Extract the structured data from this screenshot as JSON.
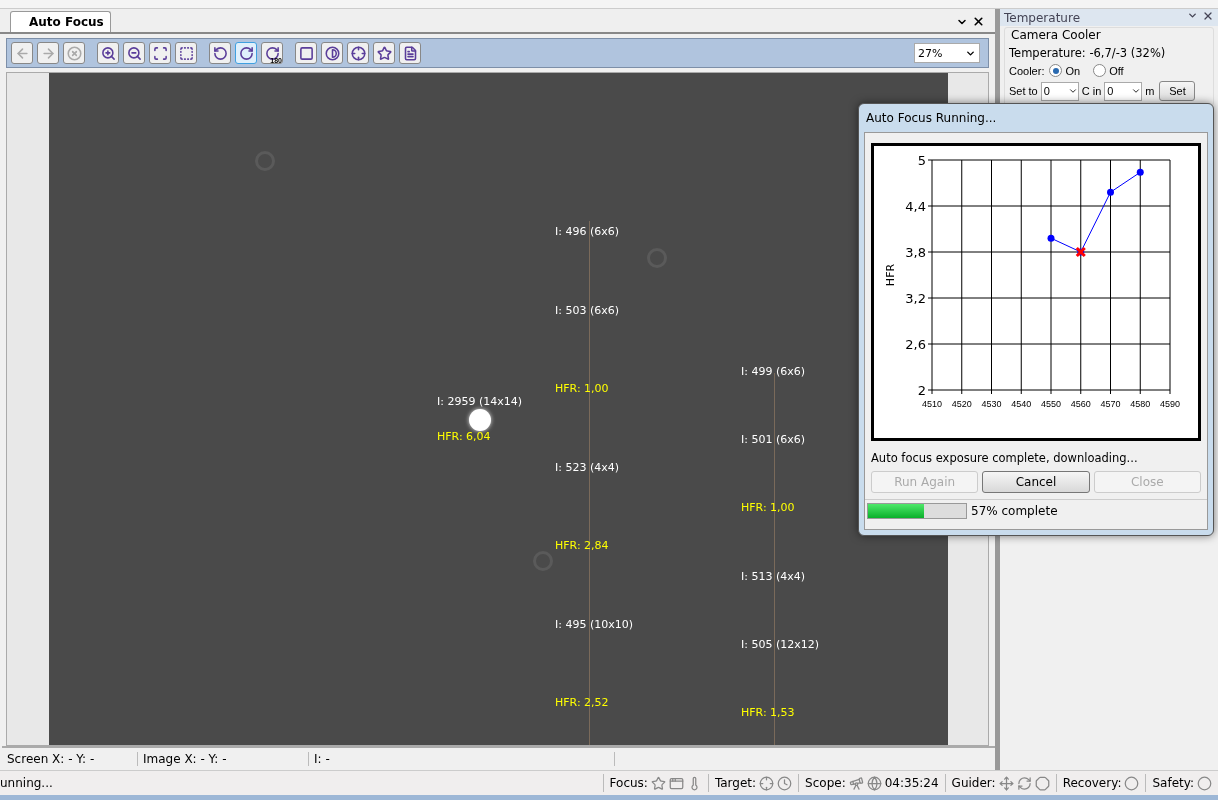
{
  "document_tab": {
    "label": "Auto Focus",
    "selected": true
  },
  "toolbar": {
    "tools": [
      {
        "kind": "back",
        "disabled": true,
        "selected": false
      },
      {
        "kind": "forward",
        "disabled": true,
        "selected": false
      },
      {
        "kind": "stop",
        "disabled": true,
        "selected": false
      },
      {
        "kind": "zoom-in",
        "disabled": false,
        "selected": false
      },
      {
        "kind": "zoom-out",
        "disabled": false,
        "selected": false
      },
      {
        "kind": "zoom-fit",
        "disabled": false,
        "selected": false
      },
      {
        "kind": "select",
        "disabled": false,
        "selected": false
      },
      {
        "kind": "rotate-left",
        "disabled": false,
        "selected": false
      },
      {
        "kind": "rotate-right",
        "disabled": false,
        "selected": true
      },
      {
        "kind": "rotate-180",
        "disabled": false,
        "selected": false,
        "badge": "180"
      },
      {
        "kind": "stretch",
        "disabled": false,
        "selected": false
      },
      {
        "kind": "contrast",
        "disabled": false,
        "selected": false
      },
      {
        "kind": "crosshair",
        "disabled": false,
        "selected": false
      },
      {
        "kind": "star",
        "disabled": false,
        "selected": false
      },
      {
        "kind": "info",
        "disabled": false,
        "selected": false
      }
    ],
    "zoom": "27%"
  },
  "image": {
    "star_clusters": [
      {
        "labels": [
          {
            "kind": "intensity",
            "text": "I: 2959 (14x14)"
          },
          {
            "kind": "hfr",
            "text": "HFR: 6,04"
          }
        ]
      },
      {
        "labels": [
          {
            "kind": "intensity",
            "text": "I: 496 (6x6)"
          },
          {
            "kind": "intensity",
            "text": "I: 503 (6x6)"
          },
          {
            "kind": "hfr",
            "text": "HFR: 1,00"
          },
          {
            "kind": "intensity",
            "text": "I: 523 (4x4)"
          },
          {
            "kind": "hfr",
            "text": "HFR: 2,84"
          },
          {
            "kind": "intensity",
            "text": "I: 495 (10x10)"
          },
          {
            "kind": "hfr",
            "text": "HFR: 2,52"
          }
        ]
      },
      {
        "labels": [
          {
            "kind": "intensity",
            "text": "I: 499 (6x6)"
          },
          {
            "kind": "intensity",
            "text": "I: 501 (6x6)"
          },
          {
            "kind": "hfr",
            "text": "HFR: 1,00"
          },
          {
            "kind": "intensity",
            "text": "I: 513 (4x4)"
          },
          {
            "kind": "intensity",
            "text": "I: 505 (12x12)"
          },
          {
            "kind": "hfr",
            "text": "HFR: 1,53"
          }
        ]
      }
    ]
  },
  "coordinates": [
    "Screen X: - Y: -",
    "Image X: - Y: -",
    "I: -"
  ],
  "temperature_panel": {
    "title": "Temperature",
    "group": "Camera Cooler",
    "reading": "Temperature: -6,7/-3 (32%)",
    "cooler_label": "Cooler:",
    "cooler_options": [
      {
        "label": "On",
        "selected": true
      },
      {
        "label": "Off",
        "selected": false
      }
    ],
    "set_to_label": "Set to",
    "set_to_value": "0",
    "c_in_label": "C in",
    "minutes_value": "0",
    "minutes_label": "m",
    "set_button": "Set"
  },
  "dialog": {
    "title": "Auto Focus Running...",
    "chart_data": {
      "type": "line",
      "ylabel": "HFR",
      "x": [
        4550,
        4560,
        4570,
        4580
      ],
      "series": [
        {
          "color": "#0000ff",
          "marker": "circle",
          "values": [
            3.98,
            3.8,
            4.58,
            4.84
          ]
        },
        {
          "color": "#ff0000",
          "marker": "cross",
          "values": [
            null,
            3.8,
            null,
            null
          ]
        }
      ],
      "grid": true,
      "xlim": [
        4510,
        4590
      ],
      "ylim": [
        2,
        5
      ],
      "xticks": [
        4510,
        4520,
        4530,
        4540,
        4550,
        4560,
        4570,
        4580,
        4590
      ],
      "yticks": [
        {
          "value": 2,
          "label": "2"
        },
        {
          "value": 2.6,
          "label": "2,6"
        },
        {
          "value": 3.2,
          "label": "3,2"
        },
        {
          "value": 3.8,
          "label": "3,8"
        },
        {
          "value": 4.4,
          "label": "4,4"
        },
        {
          "value": 5,
          "label": "5"
        }
      ]
    },
    "message": "Auto focus exposure complete, downloading...",
    "buttons": [
      {
        "label": "Run Again",
        "disabled": true
      },
      {
        "label": "Cancel",
        "disabled": false
      },
      {
        "label": "Close",
        "disabled": true
      }
    ],
    "progress": {
      "level": 0.57,
      "text": "57% complete"
    }
  },
  "status_bar": {
    "message": "unning...",
    "sections": [
      {
        "kind": "focus",
        "label": "Focus:"
      },
      {
        "kind": "target",
        "label": "Target:"
      },
      {
        "kind": "scope",
        "label": "Scope:",
        "value": "04:35:24"
      },
      {
        "kind": "guider",
        "label": "Guider:"
      },
      {
        "kind": "recovery",
        "label": "Recovery:"
      },
      {
        "kind": "safety",
        "label": "Safety:"
      }
    ]
  }
}
